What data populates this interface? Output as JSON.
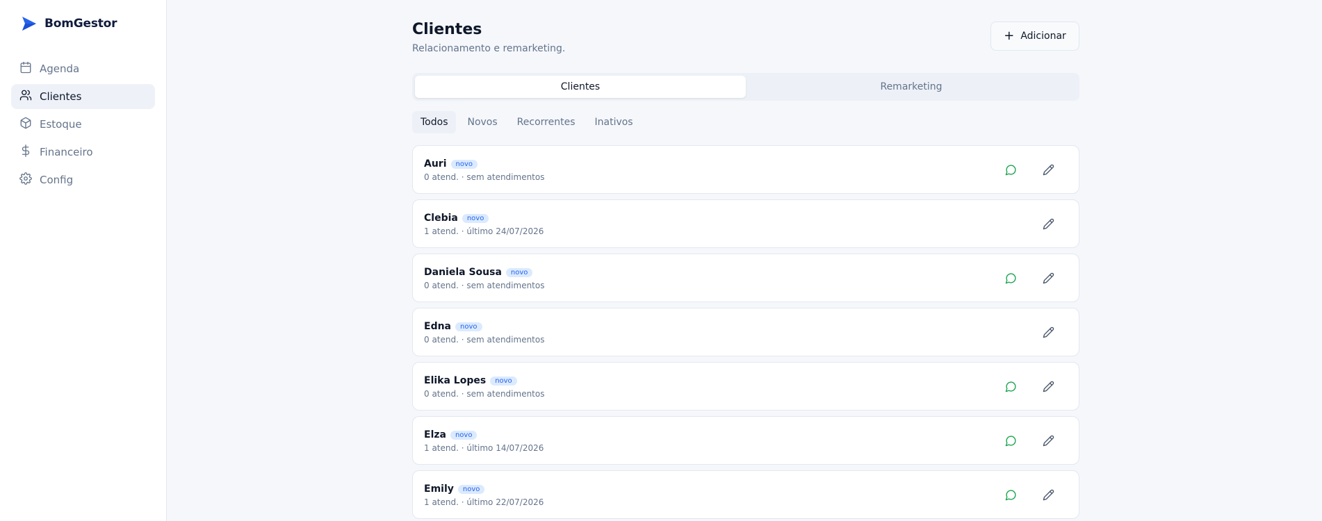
{
  "app": {
    "name": "BomGestor",
    "brand_color": "#2563eb"
  },
  "sidebar": {
    "items": [
      {
        "label": "Agenda",
        "icon": "calendar-icon"
      },
      {
        "label": "Clientes",
        "icon": "users-icon",
        "active": true
      },
      {
        "label": "Estoque",
        "icon": "box-icon"
      },
      {
        "label": "Financeiro",
        "icon": "dollar-icon"
      },
      {
        "label": "Config",
        "icon": "gear-icon"
      }
    ]
  },
  "page": {
    "title": "Clientes",
    "subtitle": "Relacionamento e remarketing.",
    "add_label": "Adicionar"
  },
  "tabs": [
    {
      "label": "Clientes",
      "active": true
    },
    {
      "label": "Remarketing"
    }
  ],
  "filters": [
    {
      "label": "Todos",
      "active": true
    },
    {
      "label": "Novos"
    },
    {
      "label": "Recorrentes"
    },
    {
      "label": "Inativos"
    }
  ],
  "clients": [
    {
      "name": "Auri",
      "badge": "novo",
      "meta": "0 atend. · sem atendimentos",
      "whatsapp": true
    },
    {
      "name": "Clebia",
      "badge": "novo",
      "meta": "1 atend. · último 24/07/2026",
      "whatsapp": false
    },
    {
      "name": "Daniela Sousa",
      "badge": "novo",
      "meta": "0 atend. · sem atendimentos",
      "whatsapp": true
    },
    {
      "name": "Edna",
      "badge": "novo",
      "meta": "0 atend. · sem atendimentos",
      "whatsapp": false
    },
    {
      "name": "Elika Lopes",
      "badge": "novo",
      "meta": "0 atend. · sem atendimentos",
      "whatsapp": true
    },
    {
      "name": "Elza",
      "badge": "novo",
      "meta": "1 atend. · último 14/07/2026",
      "whatsapp": true
    },
    {
      "name": "Emily",
      "badge": "novo",
      "meta": "1 atend. · último 22/07/2026",
      "whatsapp": true
    }
  ],
  "colors": {
    "whatsapp": "#16a34a",
    "edit": "#475569"
  }
}
